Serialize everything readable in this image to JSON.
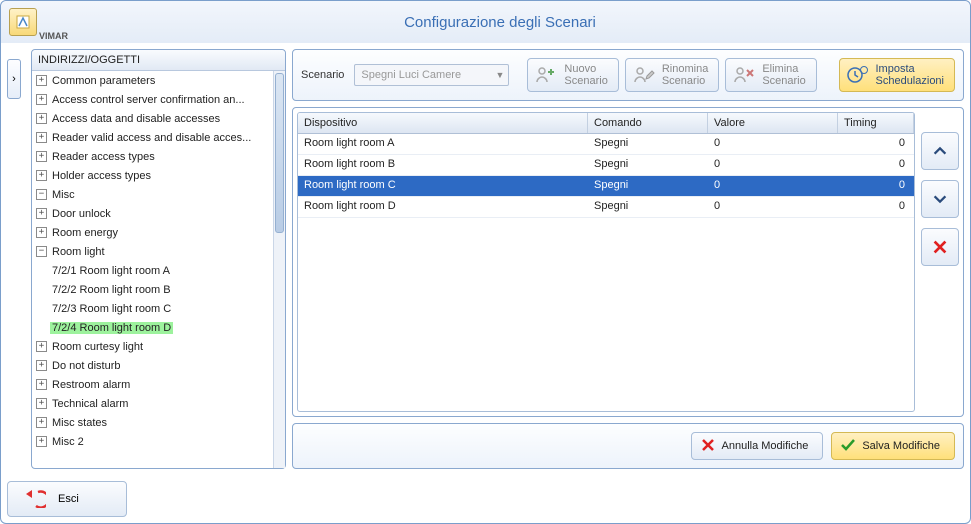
{
  "brand": "VIMAR",
  "window_title": "Configurazione degli Scenari",
  "tree": {
    "header": "INDIRIZZI/OGGETTI",
    "items": {
      "common_parameters": "Common parameters",
      "access_control_server": "Access control server confirmation an...",
      "access_data_disable": "Access data and disable accesses",
      "reader_valid_access": "Reader valid access and disable acces...",
      "reader_access_types": "Reader access types",
      "holder_access_types": "Holder access types",
      "misc": "Misc",
      "door_unlock": "Door unlock",
      "room_energy": "Room energy",
      "room_light": "Room light",
      "room_light_a": "7/2/1 Room light room A",
      "room_light_b": "7/2/2 Room light room B",
      "room_light_c": "7/2/3 Room light room C",
      "room_light_d": "7/2/4 Room light room D",
      "room_courtesy_light": "Room curtesy light",
      "do_not_disturb": "Do not disturb",
      "restroom_alarm": "Restroom alarm",
      "technical_alarm": "Technical alarm",
      "misc_states": "Misc states",
      "misc_2": "Misc 2"
    }
  },
  "toolbar": {
    "scenario_label": "Scenario",
    "scenario_value": "Spegni Luci Camere",
    "new": {
      "l1": "Nuovo",
      "l2": "Scenario"
    },
    "rename": {
      "l1": "Rinomina",
      "l2": "Scenario"
    },
    "delete": {
      "l1": "Elimina",
      "l2": "Scenario"
    },
    "schedule": {
      "l1": "Imposta",
      "l2": "Schedulazioni"
    }
  },
  "grid": {
    "headers": {
      "device": "Dispositivo",
      "command": "Comando",
      "value": "Valore",
      "timing": "Timing"
    },
    "rows": [
      {
        "device": "Room light room A",
        "command": "Spegni",
        "value": "0",
        "timing": "0",
        "selected": false
      },
      {
        "device": "Room light room B",
        "command": "Spegni",
        "value": "0",
        "timing": "0",
        "selected": false
      },
      {
        "device": "Room light room C",
        "command": "Spegni",
        "value": "0",
        "timing": "0",
        "selected": true
      },
      {
        "device": "Room light room D",
        "command": "Spegni",
        "value": "0",
        "timing": "0",
        "selected": false
      }
    ]
  },
  "footer": {
    "cancel": "Annulla Modifiche",
    "save": "Salva Modifiche"
  },
  "exit": "Esci"
}
